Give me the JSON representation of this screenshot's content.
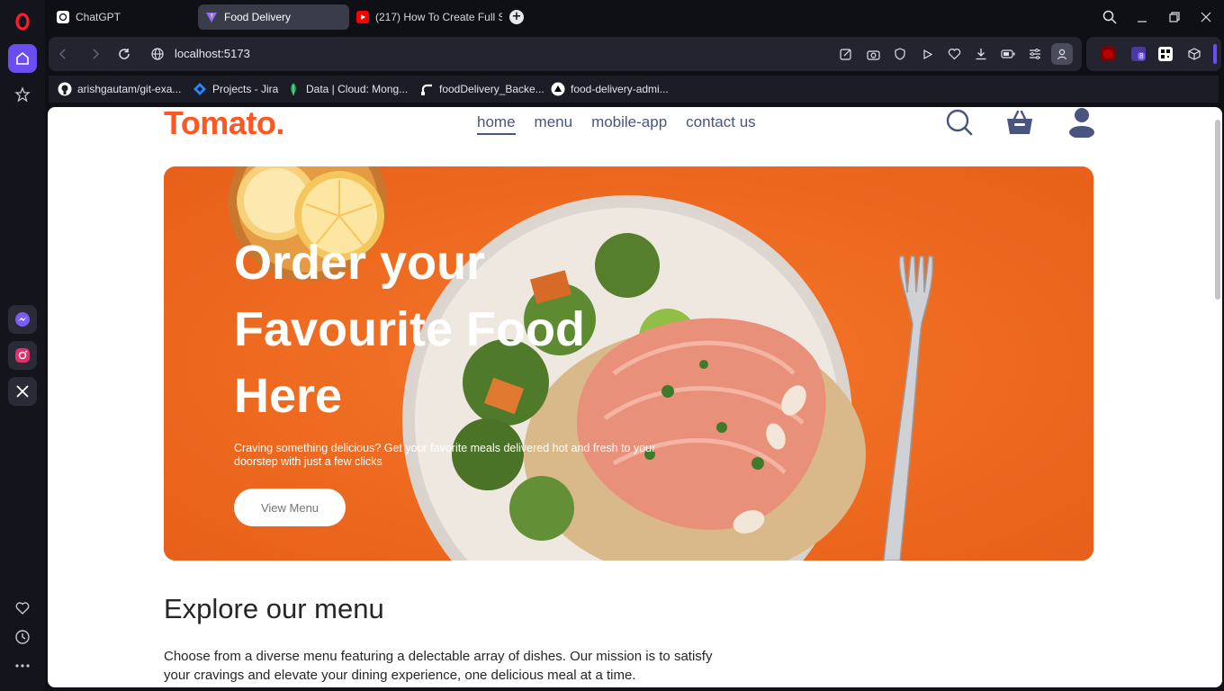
{
  "browser": {
    "tabs": [
      {
        "label": "ChatGPT"
      },
      {
        "label": "Food Delivery"
      },
      {
        "label": "(217) How To Create Full S"
      }
    ],
    "url": "localhost:5173",
    "extension_badge": "8",
    "bookmarks": [
      {
        "label": "arishgautam/git-exa..."
      },
      {
        "label": "Projects - Jira"
      },
      {
        "label": "Data | Cloud: Mong..."
      },
      {
        "label": "foodDelivery_Backe..."
      },
      {
        "label": "food-delivery-admi..."
      }
    ]
  },
  "site": {
    "logo": "Tomato.",
    "nav": [
      {
        "label": "home"
      },
      {
        "label": "menu"
      },
      {
        "label": "mobile-app"
      },
      {
        "label": "contact us"
      }
    ],
    "hero": {
      "title": "Order your Favourite Food Here",
      "subtitle": "Craving something delicious? Get your favorite meals delivered hot and fresh to your doorstep with just a few clicks",
      "button": "View Menu"
    },
    "explore": {
      "title": "Explore our menu",
      "text": "Choose from a diverse menu featuring a delectable array of dishes. Our mission is to satisfy your cravings and elevate your dining experience, one delicious meal at a time."
    }
  },
  "colors": {
    "brand": "#ff5722",
    "nav_text": "#49557e",
    "hero_bg": "#f06a22",
    "opera_accent": "#6b4df2"
  }
}
